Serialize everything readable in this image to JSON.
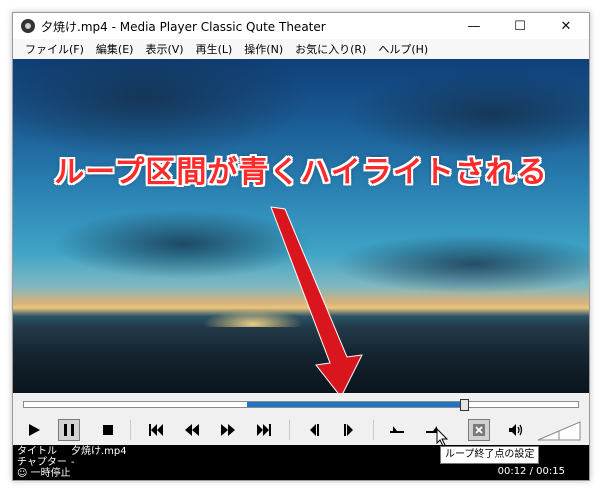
{
  "window": {
    "title": "夕焼け.mp4 - Media Player Classic Qute Theater",
    "minimize_glyph": "—",
    "maximize_glyph": "☐",
    "close_glyph": "✕"
  },
  "menu": {
    "items": [
      {
        "label": "ファイル(F)"
      },
      {
        "label": "編集(E)"
      },
      {
        "label": "表示(V)"
      },
      {
        "label": "再生(L)"
      },
      {
        "label": "操作(N)"
      },
      {
        "label": "お気に入り(R)"
      },
      {
        "label": "ヘルプ(H)"
      }
    ]
  },
  "annotation": {
    "caption": "ループ区間が青くハイライトされる"
  },
  "seekbar": {
    "loop_start": 0.402,
    "loop_end": 0.795,
    "position": 0.795,
    "colors": {
      "loop": "#1f74c6"
    }
  },
  "controls": {
    "icons": [
      "play-icon",
      "pause-icon",
      "stop-icon",
      "skip-back-icon",
      "rewind-icon",
      "fast-forward-icon",
      "skip-forward-icon",
      "frame-step-back-icon",
      "frame-step-forward-icon",
      "loop-start-icon",
      "loop-end-icon",
      "loop-toggle-icon",
      "volume-icon",
      "volume-slider"
    ]
  },
  "status": {
    "title_label": "タイトル",
    "title_value": "夕焼け.mp4",
    "chapter_label": "チャプター",
    "chapter_value": "-",
    "state": "一時停止",
    "current_time": "00:12",
    "time_separator": "/",
    "total_time": "00:15"
  },
  "tooltip": {
    "text": "ループ終了点の設定"
  }
}
